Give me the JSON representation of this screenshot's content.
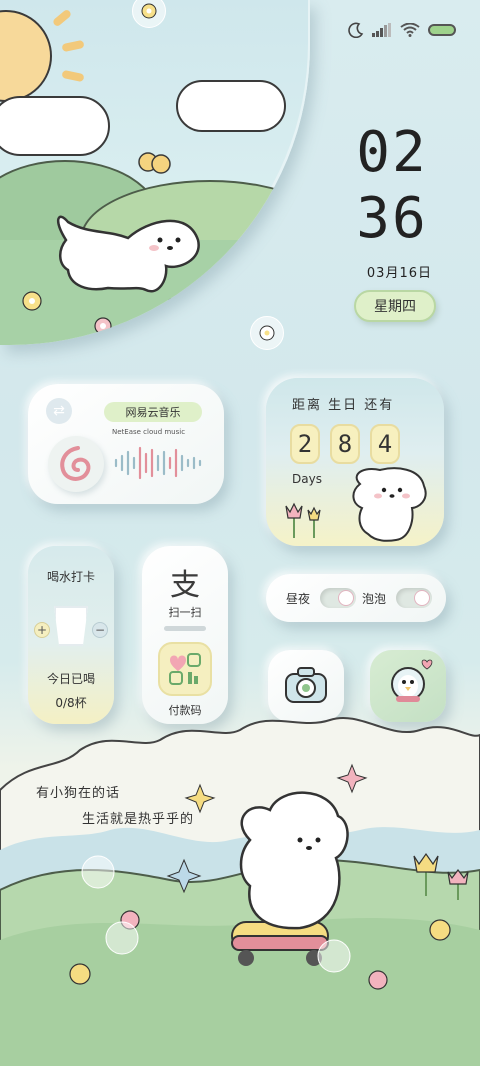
{
  "status_bar": {
    "icons": [
      "moon-icon",
      "signal-icon",
      "wifi-icon",
      "battery-icon"
    ]
  },
  "clock": {
    "hour": "02",
    "minute": "36",
    "date": "03月16日",
    "weekday": "星期四"
  },
  "music_widget": {
    "app_name": "网易云音乐",
    "subtitle": "NetEase cloud music",
    "icons": [
      "swap-icon",
      "netease-logo-icon",
      "waveform-icon"
    ]
  },
  "countdown_widget": {
    "label": "距离 生日 还有",
    "digits": [
      "2",
      "8",
      "4"
    ],
    "unit": "Days"
  },
  "water_widget": {
    "title": "喝水打卡",
    "today_label": "今日已喝",
    "count": "0/8杯"
  },
  "pay_widget": {
    "glyph": "支",
    "scan_label": "扫一扫",
    "pay_label": "付款码"
  },
  "toggles_widget": {
    "day_night_label": "昼夜",
    "bubble_label": "泡泡"
  },
  "quote": {
    "line1": "有小狗在的话",
    "line2": "生活就是热乎乎的"
  },
  "colors": {
    "background": "#d3e8ec",
    "accent_green": "#dff0c9",
    "accent_yellow": "#f7f0bf",
    "accent_pink": "#e9a3b3"
  }
}
